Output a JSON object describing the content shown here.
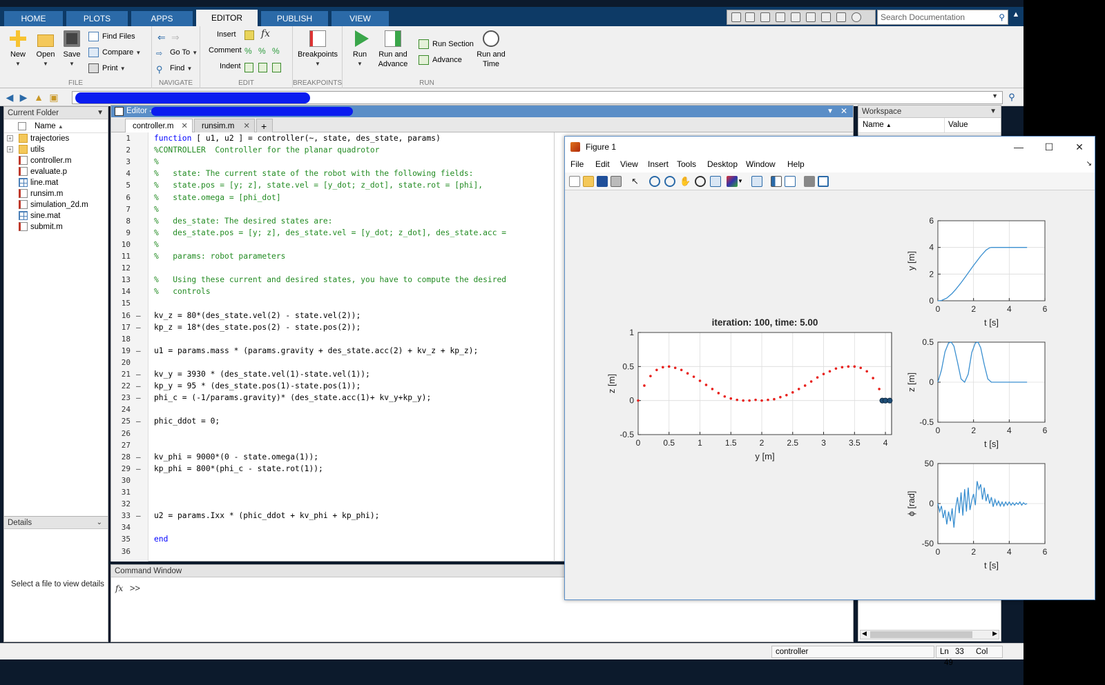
{
  "ribbon_tabs": [
    "HOME",
    "PLOTS",
    "APPS",
    "EDITOR",
    "PUBLISH",
    "VIEW"
  ],
  "search": {
    "placeholder": "Search Documentation"
  },
  "ribbon": {
    "file": {
      "label": "FILE",
      "new": "New",
      "open": "Open",
      "save": "Save",
      "find_files": "Find Files",
      "compare": "Compare",
      "print": "Print"
    },
    "navigate": {
      "label": "NAVIGATE",
      "go_to": "Go To",
      "find": "Find"
    },
    "edit": {
      "label": "EDIT",
      "insert": "Insert",
      "comment": "Comment",
      "indent": "Indent"
    },
    "breakpoints": {
      "label": "BREAKPOINTS",
      "breakpoints": "Breakpoints"
    },
    "run": {
      "label": "RUN",
      "run": "Run",
      "run_and_advance_1": "Run and",
      "run_and_advance_2": "Advance",
      "run_section": "Run Section",
      "advance": "Advance",
      "run_and_time_1": "Run and",
      "run_and_time_2": "Time"
    }
  },
  "current_folder": {
    "title": "Current Folder",
    "col_name": "Name",
    "items": [
      {
        "name": "trajectories",
        "type": "folder"
      },
      {
        "name": "utils",
        "type": "folder"
      },
      {
        "name": "controller.m",
        "type": "m"
      },
      {
        "name": "evaluate.p",
        "type": "p"
      },
      {
        "name": "line.mat",
        "type": "mat"
      },
      {
        "name": "runsim.m",
        "type": "m"
      },
      {
        "name": "simulation_2d.m",
        "type": "m"
      },
      {
        "name": "sine.mat",
        "type": "mat"
      },
      {
        "name": "submit.m",
        "type": "m"
      }
    ]
  },
  "details": {
    "title": "Details",
    "text": "Select a file to view details"
  },
  "editor": {
    "title": "Editor -",
    "tabs": [
      "controller.m",
      "runsim.m"
    ],
    "add_tab": "+",
    "lines": [
      {
        "n": "1",
        "t": "function [ u1, u2 ] = controller(~, state, des_state, params)",
        "k": "fn"
      },
      {
        "n": "2",
        "t": "%CONTROLLER  Controller for the planar quadrotor",
        "k": "c"
      },
      {
        "n": "3",
        "t": "%",
        "k": "c"
      },
      {
        "n": "4",
        "t": "%   state: The current state of the robot with the following fields:",
        "k": "c"
      },
      {
        "n": "5",
        "t": "%   state.pos = [y; z], state.vel = [y_dot; z_dot], state.rot = [phi],",
        "k": "c"
      },
      {
        "n": "6",
        "t": "%   state.omega = [phi_dot]",
        "k": "c"
      },
      {
        "n": "7",
        "t": "%",
        "k": "c"
      },
      {
        "n": "8",
        "t": "%   des_state: The desired states are:",
        "k": "c"
      },
      {
        "n": "9",
        "t": "%   des_state.pos = [y; z], des_state.vel = [y_dot; z_dot], des_state.acc =",
        "k": "c"
      },
      {
        "n": "10",
        "t": "%",
        "k": "c"
      },
      {
        "n": "11",
        "t": "%   params: robot parameters",
        "k": "c"
      },
      {
        "n": "12",
        "t": "",
        "k": ""
      },
      {
        "n": "13",
        "t": "%   Using these current and desired states, you have to compute the desired",
        "k": "c"
      },
      {
        "n": "14",
        "t": "%   controls",
        "k": "c"
      },
      {
        "n": "15",
        "t": "",
        "k": ""
      },
      {
        "n": "16",
        "t": "kv_z = 80*(des_state.vel(2) - state.vel(2));",
        "k": "",
        "d": true
      },
      {
        "n": "17",
        "t": "kp_z = 18*(des_state.pos(2) - state.pos(2));",
        "k": "",
        "d": true
      },
      {
        "n": "18",
        "t": "",
        "k": ""
      },
      {
        "n": "19",
        "t": "u1 = params.mass * (params.gravity + des_state.acc(2) + kv_z + kp_z);",
        "k": "",
        "d": true
      },
      {
        "n": "20",
        "t": "",
        "k": ""
      },
      {
        "n": "21",
        "t": "kv_y = 3930 * (des_state.vel(1)-state.vel(1));",
        "k": "",
        "d": true
      },
      {
        "n": "22",
        "t": "kp_y = 95 * (des_state.pos(1)-state.pos(1));",
        "k": "",
        "d": true
      },
      {
        "n": "23",
        "t": "phi_c = (-1/params.gravity)* (des_state.acc(1)+ kv_y+kp_y);",
        "k": "",
        "d": true
      },
      {
        "n": "24",
        "t": "",
        "k": ""
      },
      {
        "n": "25",
        "t": "phic_ddot = 0;",
        "k": "",
        "d": true
      },
      {
        "n": "26",
        "t": "",
        "k": ""
      },
      {
        "n": "27",
        "t": "",
        "k": ""
      },
      {
        "n": "28",
        "t": "kv_phi = 9000*(0 - state.omega(1));",
        "k": "",
        "d": true
      },
      {
        "n": "29",
        "t": "kp_phi = 800*(phi_c - state.rot(1));",
        "k": "",
        "d": true
      },
      {
        "n": "30",
        "t": "",
        "k": ""
      },
      {
        "n": "31",
        "t": "",
        "k": ""
      },
      {
        "n": "32",
        "t": "",
        "k": ""
      },
      {
        "n": "33",
        "t": "u2 = params.Ixx * (phic_ddot + kv_phi + kp_phi);",
        "k": "",
        "d": true
      },
      {
        "n": "34",
        "t": "",
        "k": ""
      },
      {
        "n": "35",
        "t": "end",
        "k": "kw"
      },
      {
        "n": "36",
        "t": "",
        "k": ""
      }
    ]
  },
  "command_window": {
    "title": "Command Window",
    "fx": "fx",
    "prompt": ">>"
  },
  "workspace": {
    "title": "Workspace",
    "col_name": "Name",
    "col_value": "Value"
  },
  "status": {
    "function": "controller",
    "ln_label": "Ln",
    "ln": "33",
    "col_label": "Col",
    "col": "49"
  },
  "figure": {
    "title": "Figure 1",
    "menu": [
      "File",
      "Edit",
      "View",
      "Insert",
      "Tools",
      "Desktop",
      "Window",
      "Help"
    ],
    "colors": {
      "trajectory": "#e8211d",
      "line": "#3a8fd0",
      "robot": "#1f4f78"
    }
  },
  "chart_data": [
    {
      "type": "scatter",
      "title": "iteration: 100, time: 5.00",
      "xlabel": "y [m]",
      "ylabel": "z [m]",
      "xlim": [
        0,
        4.1
      ],
      "ylim": [
        -0.5,
        1
      ],
      "xticks": [
        "0",
        "0.5",
        "1",
        "1.5",
        "2",
        "2.5",
        "3",
        "3.5",
        "4"
      ],
      "yticks": [
        "-0.5",
        "0",
        "0.5",
        "1"
      ],
      "grid": true,
      "x": [
        0,
        0.1,
        0.2,
        0.3,
        0.4,
        0.5,
        0.6,
        0.7,
        0.8,
        0.9,
        1.0,
        1.1,
        1.2,
        1.3,
        1.4,
        1.5,
        1.6,
        1.7,
        1.8,
        1.9,
        2.0,
        2.1,
        2.2,
        2.3,
        2.4,
        2.5,
        2.6,
        2.7,
        2.8,
        2.9,
        3.0,
        3.1,
        3.2,
        3.3,
        3.4,
        3.5,
        3.6,
        3.7,
        3.8,
        3.9,
        4.0
      ],
      "y": [
        0,
        0.22,
        0.36,
        0.45,
        0.49,
        0.5,
        0.48,
        0.45,
        0.4,
        0.35,
        0.29,
        0.23,
        0.17,
        0.11,
        0.06,
        0.03,
        0.01,
        0,
        0,
        0.01,
        0.0,
        0.01,
        0.02,
        0.05,
        0.08,
        0.12,
        0.17,
        0.22,
        0.28,
        0.34,
        0.39,
        0.43,
        0.47,
        0.49,
        0.5,
        0.5,
        0.48,
        0.43,
        0.33,
        0.17,
        0
      ],
      "robot_y": [
        3.95,
        4.0,
        4.07
      ],
      "robot_z": [
        0,
        0,
        0
      ]
    },
    {
      "type": "line",
      "xlabel": "t [s]",
      "ylabel": "y [m]",
      "xlim": [
        0,
        6
      ],
      "ylim": [
        0,
        6
      ],
      "xticks": [
        "0",
        "2",
        "4",
        "6"
      ],
      "yticks": [
        "0",
        "2",
        "4",
        "6"
      ],
      "grid": true,
      "series": [
        {
          "x": [
            0,
            0.2,
            0.5,
            0.8,
            1.0,
            1.3,
            1.6,
            2.0,
            2.4,
            2.7,
            2.9,
            3.0,
            3.2,
            3.5,
            4.0,
            4.5,
            5.0
          ],
          "values": [
            0,
            0.02,
            0.2,
            0.55,
            0.85,
            1.35,
            1.9,
            2.65,
            3.35,
            3.8,
            3.97,
            4.0,
            4.0,
            4.0,
            4.0,
            4.0,
            4.0
          ]
        }
      ]
    },
    {
      "type": "line",
      "xlabel": "t [s]",
      "ylabel": "z [m]",
      "xlim": [
        0,
        6
      ],
      "ylim": [
        -0.5,
        0.5
      ],
      "xticks": [
        "0",
        "2",
        "4",
        "6"
      ],
      "yticks": [
        "-0.5",
        "0",
        "0.5"
      ],
      "grid": true,
      "series": [
        {
          "x": [
            0,
            0.2,
            0.4,
            0.6,
            0.75,
            0.9,
            1.1,
            1.3,
            1.5,
            1.7,
            1.9,
            2.1,
            2.25,
            2.4,
            2.6,
            2.8,
            3.0,
            3.2,
            4.0,
            5.0
          ],
          "values": [
            0,
            0.15,
            0.38,
            0.49,
            0.5,
            0.45,
            0.25,
            0.04,
            0,
            0.1,
            0.37,
            0.49,
            0.5,
            0.43,
            0.22,
            0.04,
            0,
            0,
            0,
            0
          ]
        }
      ]
    },
    {
      "type": "line",
      "xlabel": "t [s]",
      "ylabel": "ϕ [rad]",
      "xlim": [
        0,
        6
      ],
      "ylim": [
        -50,
        50
      ],
      "xticks": [
        "0",
        "2",
        "4",
        "6"
      ],
      "yticks": [
        "-50",
        "0",
        "50"
      ],
      "grid": true,
      "series": [
        {
          "x": [
            0,
            0.1,
            0.2,
            0.3,
            0.4,
            0.5,
            0.6,
            0.7,
            0.8,
            0.9,
            1.0,
            1.1,
            1.2,
            1.3,
            1.4,
            1.5,
            1.6,
            1.7,
            1.8,
            1.9,
            2.0,
            2.1,
            2.2,
            2.3,
            2.4,
            2.5,
            2.6,
            2.7,
            2.8,
            2.9,
            3.0,
            3.1,
            3.2,
            3.3,
            3.4,
            3.5,
            3.6,
            3.7,
            3.8,
            3.9,
            4.0,
            4.1,
            4.2,
            4.3,
            4.4,
            4.5,
            4.6,
            4.7,
            4.8,
            4.9,
            5.0
          ],
          "values": [
            0,
            -10,
            -3,
            -18,
            -8,
            -26,
            -10,
            -22,
            -6,
            -30,
            -5,
            8,
            -12,
            14,
            -15,
            18,
            -10,
            20,
            -8,
            4,
            12,
            -2,
            28,
            18,
            24,
            5,
            20,
            3,
            12,
            0,
            8,
            -4,
            5,
            -2,
            3,
            -3,
            2,
            -3,
            2,
            -2,
            2,
            -2,
            1,
            -2,
            1,
            -1,
            2,
            -2,
            1,
            -1,
            0
          ]
        }
      ]
    }
  ]
}
